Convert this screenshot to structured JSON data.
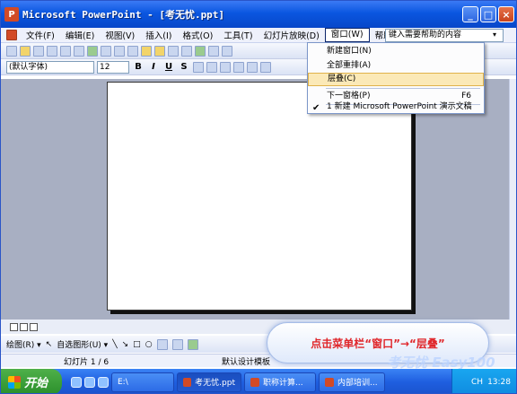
{
  "window": {
    "title": "Microsoft PowerPoint - [考无忧.ppt]",
    "app_icon": "P",
    "btn_min": "_",
    "btn_max": "□",
    "btn_close": "×"
  },
  "menubar": {
    "items": [
      "文件(F)",
      "编辑(E)",
      "视图(V)",
      "插入(I)",
      "格式(O)",
      "工具(T)",
      "幻灯片放映(D)",
      "窗口(W)",
      "帮助(H)"
    ],
    "help_placeholder": "键入需要帮助的内容"
  },
  "format_toolbar": {
    "font": "(默认字体)",
    "size": "12",
    "bold": "B",
    "italic": "I",
    "underline": "U",
    "shadow": "S"
  },
  "window_menu": {
    "items": [
      {
        "label": "新建窗口(N)",
        "shortcut": ""
      },
      {
        "label": "全部重排(A)",
        "shortcut": ""
      },
      {
        "label": "层叠(C)",
        "shortcut": ""
      },
      {
        "label": "下一窗格(P)",
        "shortcut": "F6"
      },
      {
        "label": "1 新建 Microsoft PowerPoint 演示文稿",
        "shortcut": ""
      }
    ],
    "check": "✔"
  },
  "draw_toolbar": {
    "draw": "绘图(R) ▾",
    "autoshapes": "自选图形(U) ▾"
  },
  "statusbar": {
    "slide": "幻灯片 1 / 6",
    "design": "默认设计模板"
  },
  "callout": {
    "text": "点击菜单栏“窗口”→“层叠”"
  },
  "watermark": "考无忧 Easy100",
  "taskbar": {
    "start": "开始",
    "tasks": [
      {
        "label": "E:\\"
      },
      {
        "label": "考无忧.ppt"
      },
      {
        "label": "职称计算..."
      },
      {
        "label": "内部培训..."
      }
    ],
    "tray_lang": "CH",
    "clock": "13:28"
  }
}
